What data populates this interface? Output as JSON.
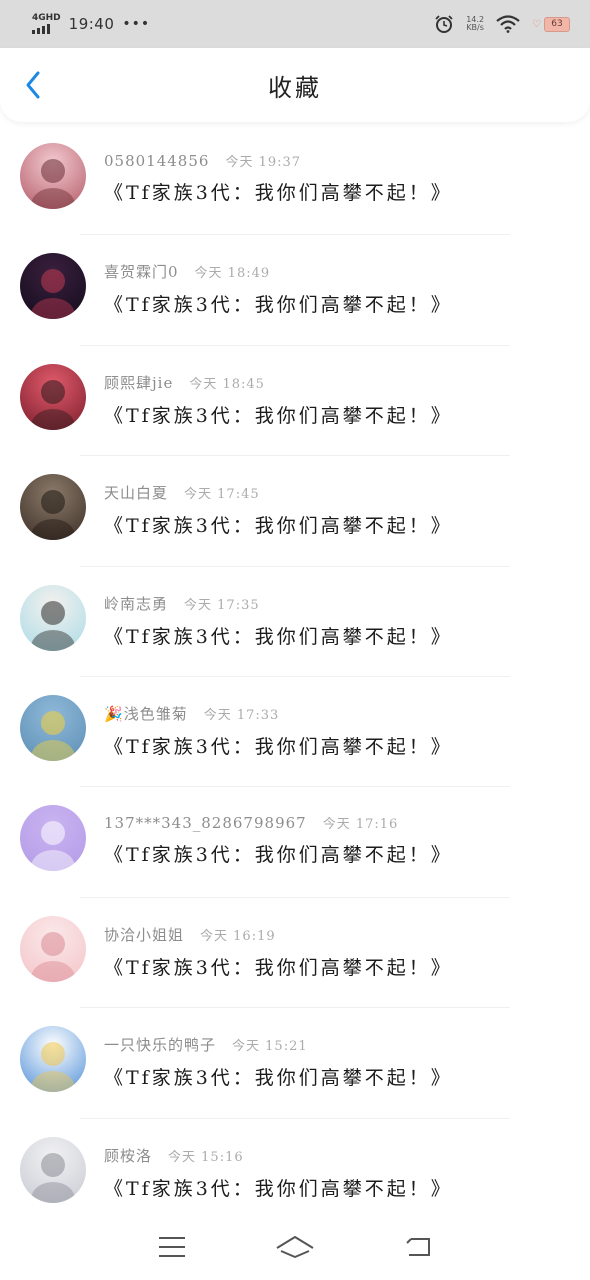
{
  "status_bar": {
    "network": "4GHD",
    "time": "19:40",
    "more": "•••",
    "speed_value": "14.2",
    "speed_unit": "KB/s",
    "battery": "63"
  },
  "nav": {
    "title": "收藏"
  },
  "favorites": [
    {
      "author": "0580144856",
      "emoji": "",
      "time": "今天 19:37",
      "text": "《Tf家族3代：我你们高攀不起！》",
      "avatar": {
        "bg1": "#f3c9d0",
        "bg2": "#b25a66",
        "fg": "#6a2c34"
      }
    },
    {
      "author": "喜贺霖门0",
      "emoji": "",
      "time": "今天 18:49",
      "text": "《Tf家族3代：我你们高攀不起！》",
      "avatar": {
        "bg1": "#3a1f3d",
        "bg2": "#120c1c",
        "fg": "#c23a52"
      }
    },
    {
      "author": "顾熙肆jie",
      "emoji": "",
      "time": "今天 18:45",
      "text": "《Tf家族3代：我你们高攀不起！》",
      "avatar": {
        "bg1": "#e05a6a",
        "bg2": "#7a1d2c",
        "fg": "#2a1a1c"
      }
    },
    {
      "author": "天山白夏",
      "emoji": "",
      "time": "今天 17:45",
      "text": "《Tf家族3代：我你们高攀不起！》",
      "avatar": {
        "bg1": "#8b7a6a",
        "bg2": "#3b2e26",
        "fg": "#1e1712"
      }
    },
    {
      "author": "岭南志勇",
      "emoji": "",
      "time": "今天 17:35",
      "text": "《Tf家族3代：我你们高攀不起！》",
      "avatar": {
        "bg1": "#f4f1ee",
        "bg2": "#a9dbe6",
        "fg": "#2b2b2b"
      }
    },
    {
      "author": "浅色雏菊",
      "emoji": "🎉",
      "time": "今天 17:33",
      "text": "《Tf家族3代：我你们高攀不起！》",
      "avatar": {
        "bg1": "#8fb8d8",
        "bg2": "#5b8fb5",
        "fg": "#f3d23a"
      }
    },
    {
      "author": "137***343_8286798967",
      "emoji": "",
      "time": "今天 17:16",
      "text": "《Tf家族3代：我你们高攀不起！》",
      "avatar": {
        "bg1": "#c9b3f0",
        "bg2": "#b49be8",
        "fg": "#ffffff"
      }
    },
    {
      "author": "协洽小姐姐",
      "emoji": "",
      "time": "今天 16:19",
      "text": "《Tf家族3代：我你们高攀不起！》",
      "avatar": {
        "bg1": "#fbe9ea",
        "bg2": "#f3c3c7",
        "fg": "#d98a93"
      }
    },
    {
      "author": "一只快乐的鸭子",
      "emoji": "",
      "time": "今天 15:21",
      "text": "《Tf家族3代：我你们高攀不起！》",
      "avatar": {
        "bg1": "#ffffff",
        "bg2": "#4f8fd8",
        "fg": "#f0c64a"
      }
    },
    {
      "author": "顾桉洛",
      "emoji": "",
      "time": "今天 15:16",
      "text": "《Tf家族3代：我你们高攀不起！》",
      "avatar": {
        "bg1": "#f2f2f4",
        "bg2": "#c8cad2",
        "fg": "#8a8c96"
      }
    }
  ],
  "colors": {
    "accent": "#1e88e5",
    "status_bar_bg": "#dcdcdc",
    "author_text": "#8d8d8d",
    "time_text": "#ababab",
    "body_text": "#1c1c1c"
  },
  "bottom_nav": {
    "items": [
      "menu-icon",
      "home-icon",
      "back-icon"
    ]
  }
}
